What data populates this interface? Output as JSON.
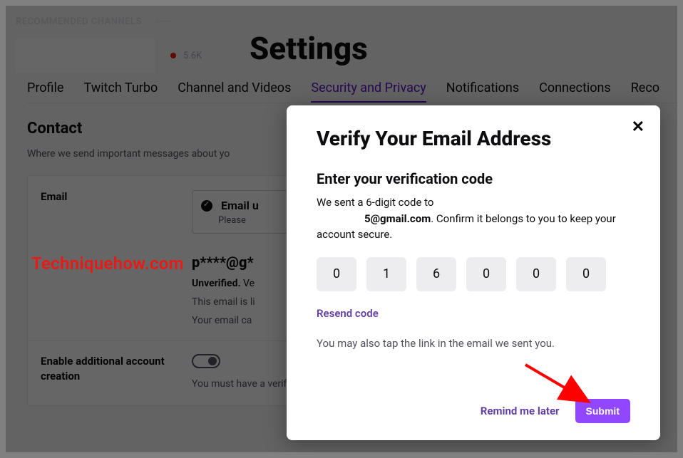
{
  "sidebar": {
    "recommended_label": "RECOMMENDED CHANNELS",
    "viewer_count": "5.6K"
  },
  "page": {
    "title": "Settings",
    "tabs": [
      "Profile",
      "Twitch Turbo",
      "Channel and Videos",
      "Security and Privacy",
      "Notifications",
      "Connections",
      "Reco"
    ],
    "active_tab_index": 3
  },
  "contact_section": {
    "heading": "Contact",
    "sub": "Where we send important messages about yo",
    "email_label": "Email",
    "status_title": "Email u",
    "status_sub": "Please",
    "email_value": "p****@g*",
    "unverified_prefix": "Unverified.",
    "unverified_text": " Ve",
    "line2": "This email is li",
    "line3": "Your email ca",
    "enable_label": "Enable additional account creation",
    "enable_sub": "You must have a verified email address to modify this setting"
  },
  "watermark": "Techniquehow.com",
  "modal": {
    "title": "Verify Your Email Address",
    "subtitle": "Enter your verification code",
    "sent_prefix": "We sent a 6-digit code to",
    "email_masked": "5@gmail.com",
    "sent_suffix": ". Confirm it belongs to you to keep your account secure.",
    "code": [
      "0",
      "1",
      "6",
      "0",
      "0",
      "0"
    ],
    "resend": "Resend code",
    "tap_hint": "You may also tap the link in the email we sent you.",
    "remind": "Remind me later",
    "submit": "Submit"
  }
}
